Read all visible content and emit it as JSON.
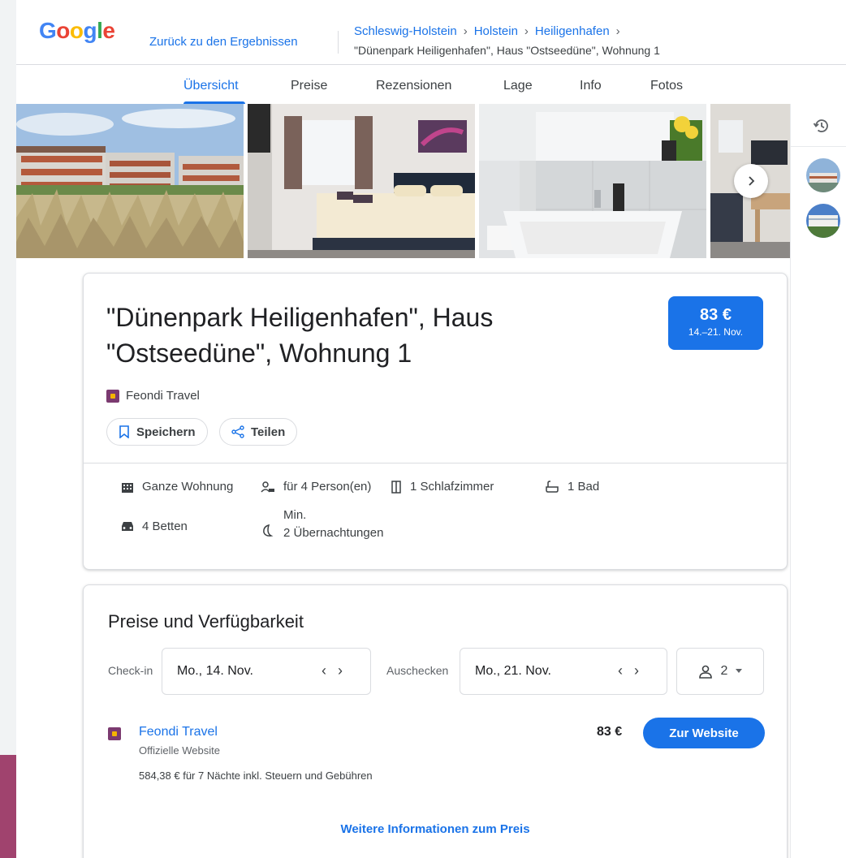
{
  "header": {
    "logo": "Google",
    "back_link": "Zurück zu den Ergebnissen",
    "breadcrumb": [
      "Schleswig-Holstein",
      "Holstein",
      "Heiligenhafen"
    ],
    "breadcrumb_current": "\"Dünenpark Heiligenhafen\", Haus \"Ostseedüne\", Wohnung 1"
  },
  "tabs": [
    "Übersicht",
    "Preise",
    "Rezensionen",
    "Lage",
    "Info",
    "Fotos"
  ],
  "active_tab": "Übersicht",
  "listing": {
    "title": "\"Dünenpark Heiligenhafen\", Haus \"Ostseedüne\", Wohnung 1",
    "price": "83 €",
    "price_dates": "14.–21. Nov.",
    "provider": "Feondi Travel",
    "save_label": "Speichern",
    "share_label": "Teilen",
    "amenities": {
      "type": "Ganze Wohnung",
      "persons": "für 4 Person(en)",
      "bedrooms": "1 Schlafzimmer",
      "bath": "1 Bad",
      "beds": "4 Betten",
      "min_nights_label": "Min.",
      "min_nights": "2 Übernachtungen"
    }
  },
  "availability": {
    "title": "Preise und Verfügbarkeit",
    "checkin_label": "Check-in",
    "checkin_value": "Mo., 14. Nov.",
    "checkout_label": "Auschecken",
    "checkout_value": "Mo., 21. Nov.",
    "guests": "2",
    "offer": {
      "name": "Feondi Travel",
      "subtitle": "Offizielle Website",
      "price": "83 €",
      "button": "Zur Website",
      "total": "584,38 € für 7 Nächte inkl. Steuern und Gebühren"
    },
    "more_info": "Weitere Informationen zum Preis"
  },
  "colors": {
    "accent": "#1a73e8",
    "provider_icon": "#7b3a70",
    "side_strip": "#a0436e"
  },
  "icons": [
    "history-icon",
    "chevron-right-icon",
    "bookmark-icon",
    "share-icon",
    "building-icon",
    "person-icon",
    "door-icon",
    "bath-icon",
    "car-bed-icon",
    "moon-icon",
    "person-outline-icon",
    "dropdown-arrow-icon"
  ]
}
